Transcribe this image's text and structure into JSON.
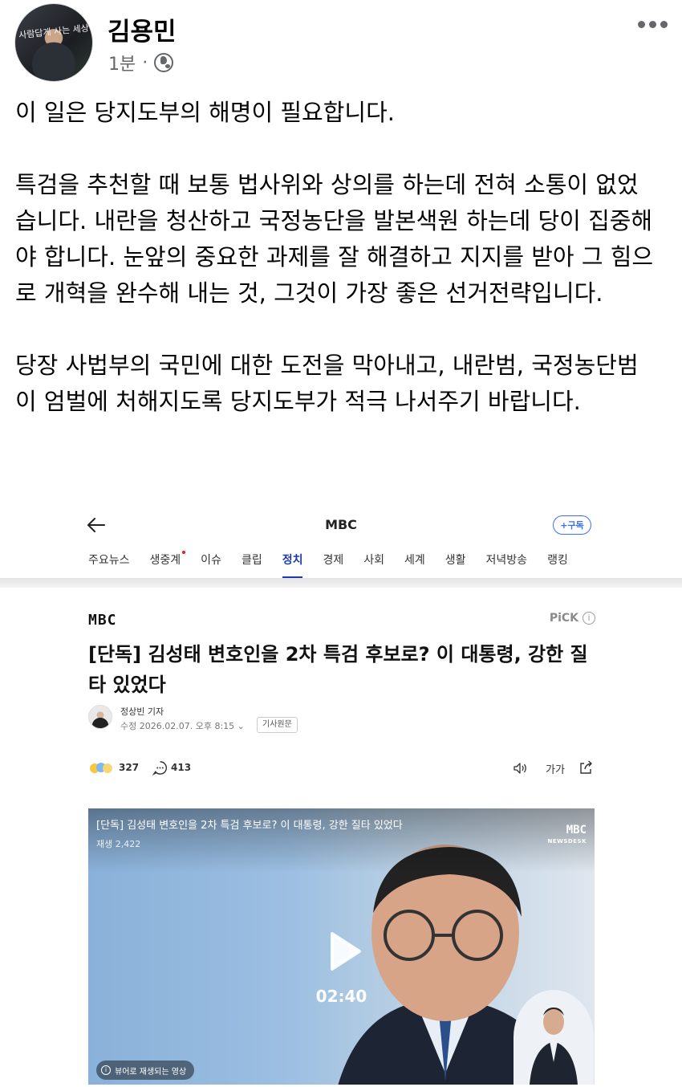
{
  "post": {
    "author": "김용민",
    "avatar_overlay_text": "사람답게 사는 세상",
    "time": "1분",
    "separator": "·",
    "paragraphs": [
      "이 일은 당지도부의 해명이 필요합니다.",
      "특검을 추천할 때 보통 법사위와 상의를 하는데 전혀 소통이 없었습니다. 내란을 청산하고 국정농단을 발본색원 하는데 당이 집중해야 합니다. 눈앞의 중요한 과제를 잘 해결하고 지지를 받아 그 힘으로 개혁을 완수해 내는 것, 그것이 가장 좋은 선거전략입니다.",
      "당장 사법부의 국민에 대한 도전을 막아내고, 내란범, 국정농단범이 엄벌에 처해지도록 당지도부가 적극 나서주기 바랍니다."
    ]
  },
  "article": {
    "topbar": {
      "title": "MBC",
      "subscribe_label": "+구독"
    },
    "categories": [
      {
        "label": "주요뉴스",
        "active": false,
        "dot": false
      },
      {
        "label": "생중계",
        "active": false,
        "dot": true
      },
      {
        "label": "이슈",
        "active": false,
        "dot": false
      },
      {
        "label": "클립",
        "active": false,
        "dot": false
      },
      {
        "label": "정치",
        "active": true,
        "dot": false
      },
      {
        "label": "경제",
        "active": false,
        "dot": false
      },
      {
        "label": "사회",
        "active": false,
        "dot": false
      },
      {
        "label": "세계",
        "active": false,
        "dot": false
      },
      {
        "label": "생활",
        "active": false,
        "dot": false
      },
      {
        "label": "저녁방송",
        "active": false,
        "dot": false
      },
      {
        "label": "랭킹",
        "active": false,
        "dot": false
      }
    ],
    "press_logo": "MBC",
    "pick_label": "PiCK",
    "headline": "[단독] 김성태 변호인을 2차 특검 후보로? 이 대통령, 강한 질타 있었다",
    "reporter_name": "정상빈 기자",
    "updated": "수정 2026.02.07. 오후 8:15",
    "original_button": "기사원문",
    "reactions": "327",
    "comments": "413",
    "fontsize_label": "가가",
    "video": {
      "title": "[단독] 김성태 변호인을 2차 특검 후보로? 이 대통령, 강한 질타 있었다",
      "views": "재생 2,422",
      "logo_main": "MBC",
      "logo_sub": "NEWSDESK",
      "duration": "02:40",
      "muted_notice": "뷰어로 재생되는 영상"
    }
  },
  "colors": {
    "accent_blue": "#1a3bb0",
    "subscribe_blue": "#3b6ff5",
    "meta_gray": "#65676b"
  }
}
